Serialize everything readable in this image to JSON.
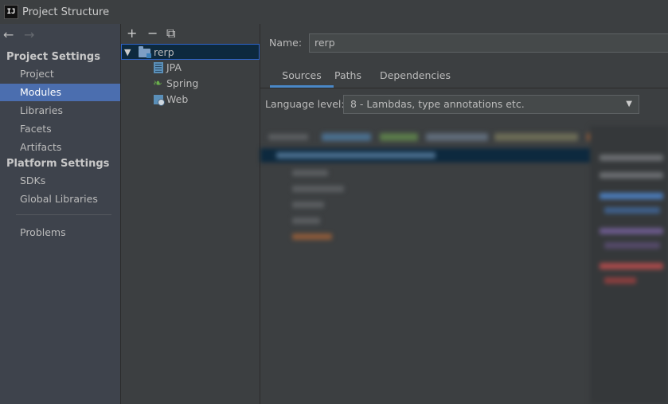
{
  "window": {
    "title": "Project Structure",
    "app_icon": "IJ"
  },
  "nav": {
    "back_icon": "←",
    "forward_icon": "→"
  },
  "sidebar": {
    "project_settings_header": "Project Settings",
    "project_items": [
      "Project",
      "Modules",
      "Libraries",
      "Facets",
      "Artifacts"
    ],
    "platform_settings_header": "Platform Settings",
    "platform_items": [
      "SDKs",
      "Global Libraries"
    ],
    "problems_label": "Problems",
    "selected": "Modules"
  },
  "toolbar": {
    "add_icon": "+",
    "remove_icon": "−",
    "copy_icon": "⧉"
  },
  "module_tree": {
    "module": "rerp",
    "facets": [
      "JPA",
      "Spring",
      "Web"
    ]
  },
  "details": {
    "name_label": "Name:",
    "name_value": "rerp",
    "tabs": [
      "Sources",
      "Paths",
      "Dependencies"
    ],
    "active_tab": "Sources",
    "language_level_label": "Language level:",
    "language_level_value": "8 - Lambdas, type annotations etc."
  },
  "colors": {
    "selection": "#4b6eaf",
    "tree_selection": "#0d293e",
    "accent": "#4a88c7",
    "background": "#3c3f41"
  }
}
